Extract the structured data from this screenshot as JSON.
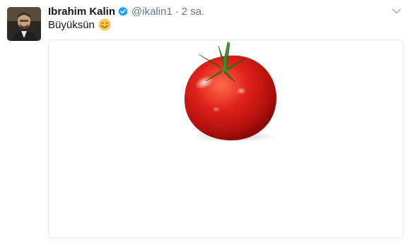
{
  "tweet": {
    "author_name": "Ibrahim Kalin",
    "verified": true,
    "handle": "@ikalin1",
    "separator": "·",
    "timestamp": "2 sa.",
    "text": "Büyüksün",
    "emoji": "smiling-blushing-face",
    "media": {
      "subject": "tomato"
    }
  },
  "colors": {
    "verified_badge": "#1da1f2",
    "muted_text": "#657786",
    "card_border": "#e1e8ed",
    "tomato_red": "#e0201a"
  }
}
